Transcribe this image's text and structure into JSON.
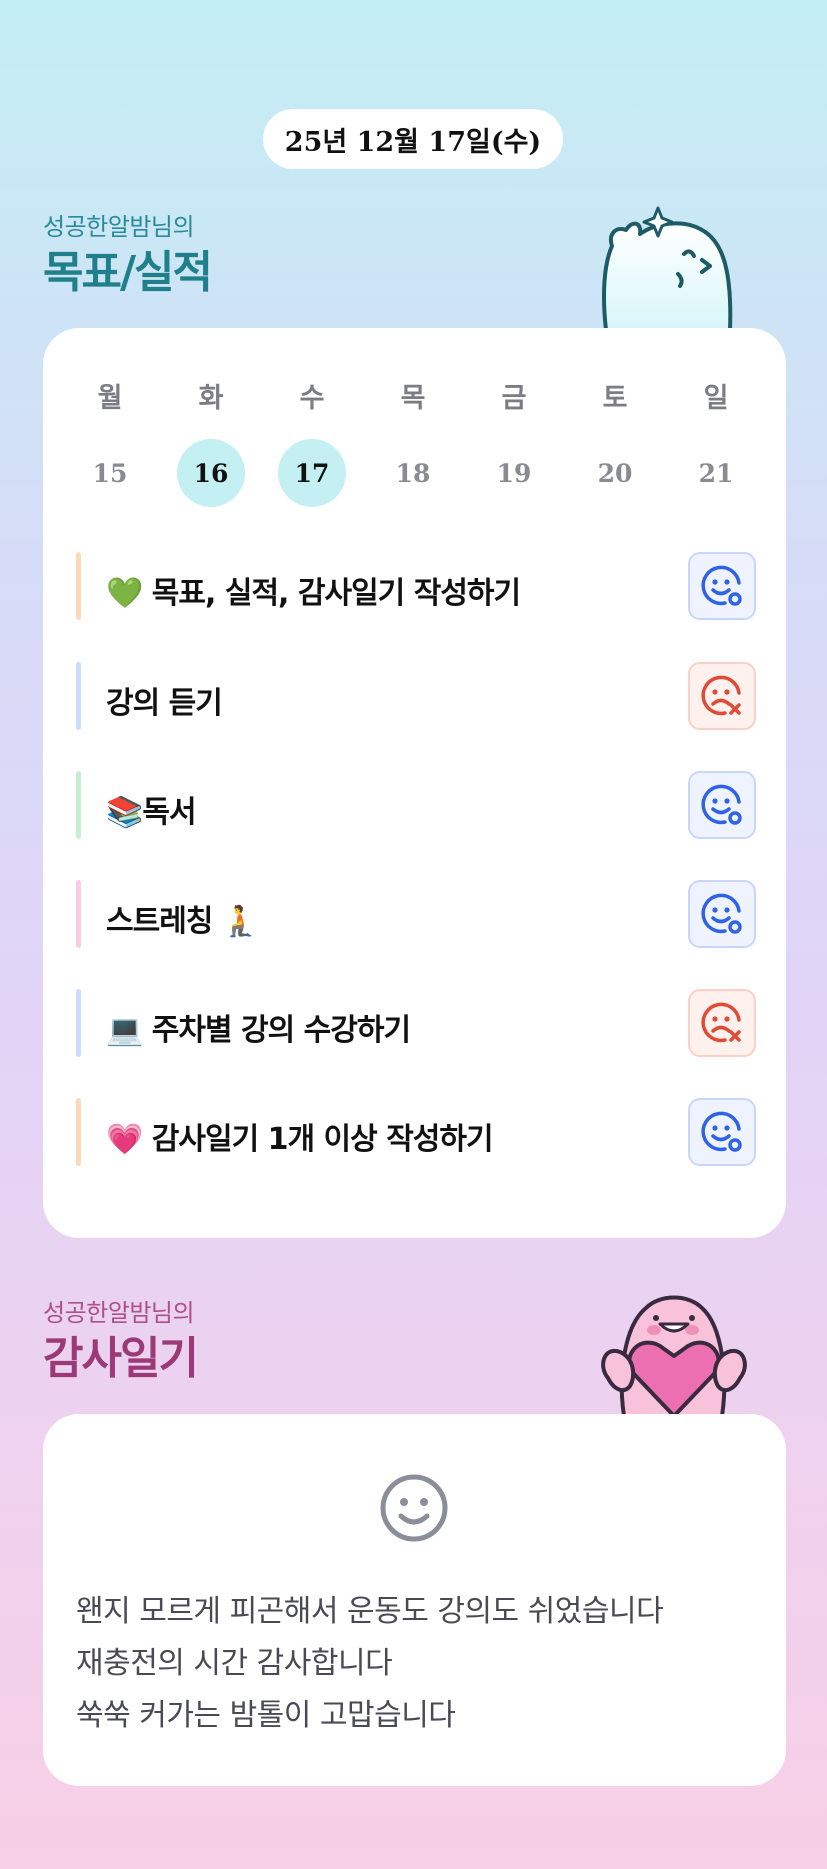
{
  "date_label": "25년 12월 17일(수)",
  "goals_section": {
    "subtitle": "성공한알밤님의",
    "title": "목표/실적"
  },
  "week": {
    "days": [
      {
        "name": "월",
        "num": "15",
        "selected": false
      },
      {
        "name": "화",
        "num": "16",
        "selected": true
      },
      {
        "name": "수",
        "num": "17",
        "selected": true
      },
      {
        "name": "목",
        "num": "18",
        "selected": false
      },
      {
        "name": "금",
        "num": "19",
        "selected": false
      },
      {
        "name": "토",
        "num": "20",
        "selected": false
      },
      {
        "name": "일",
        "num": "21",
        "selected": false
      }
    ]
  },
  "goals": [
    {
      "emoji": "💚",
      "text": "목표, 실적, 감사일기 작성하기",
      "label": "💚 목표, 실적, 감사일기 작성하기",
      "status": "done",
      "bar_color": "#fcd9b8"
    },
    {
      "emoji": "",
      "text": "강의 듣기",
      "label": "강의 듣기",
      "status": "missed",
      "bar_color": "#cddcfa"
    },
    {
      "emoji": "📚",
      "text": "독서",
      "label": "📚독서",
      "status": "done",
      "bar_color": "#c6f0d5"
    },
    {
      "emoji": "🧎",
      "text": "스트레칭",
      "label": "스트레칭 🧎",
      "status": "done",
      "bar_color": "#f9cce3"
    },
    {
      "emoji": "💻",
      "text": "주차별 강의 수강하기",
      "label": "💻 주차별 강의 수강하기",
      "status": "missed",
      "bar_color": "#cddcfa"
    },
    {
      "emoji": "💗",
      "text": "감사일기 1개 이상 작성하기",
      "label": "💗 감사일기 1개 이상 작성하기",
      "status": "done",
      "bar_color": "#fcd9b8"
    }
  ],
  "thanks_section": {
    "subtitle": "성공한알밤님의",
    "title": "감사일기"
  },
  "thanks_diary": {
    "icon": "smile-face-icon",
    "lines": [
      "왠지 모르게 피곤해서 운동도 강의도 쉬었습니다",
      "재충전의 시간 감사합니다",
      "쑥쑥 커가는 밤톨이 고맙습니다"
    ]
  },
  "colors": {
    "goal_title": "#1f7f8b",
    "thanks_title": "#9c3a78",
    "done_icon": "#2f62e6",
    "missed_icon": "#e14a35",
    "selected_day": "#c4eff3"
  }
}
